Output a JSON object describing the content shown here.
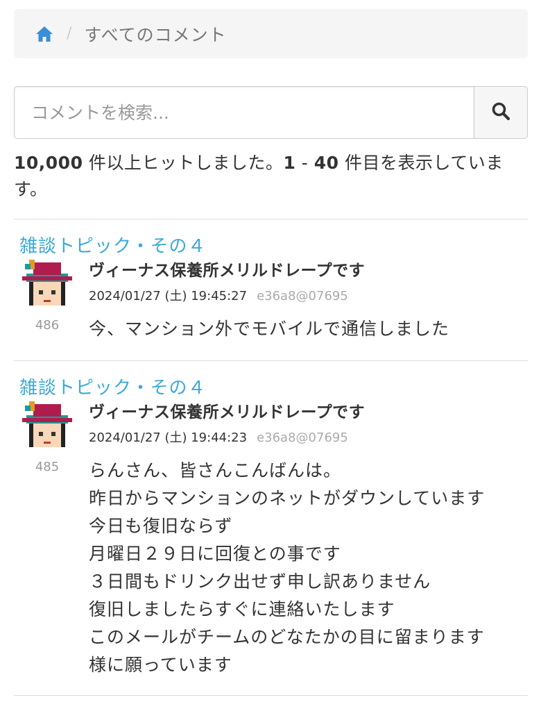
{
  "breadcrumb": {
    "home_icon": "home-icon",
    "separator": "/",
    "current": "すべてのコメント"
  },
  "search": {
    "placeholder": "コメントを検索...",
    "value": "",
    "button_icon": "search-icon"
  },
  "results": {
    "total": "10,000",
    "total_suffix": " 件以上ヒットしました。",
    "range_start": "1",
    "range_sep": " - ",
    "range_end": "40",
    "range_suffix": " 件目を表示しています。"
  },
  "colors": {
    "link": "#3ba9d8",
    "home_icon": "#3a8fd6",
    "breadcrumb_bg": "#f5f5f5"
  },
  "comments": [
    {
      "topic": "雑談トピック・その４",
      "author": "ヴィーナス保養所メリルドレープです",
      "datetime": "2024/01/27 (土) 19:45:27",
      "hash": "e36a8@07695",
      "rank": "486",
      "body": "今、マンション外でモバイルで通信しました"
    },
    {
      "topic": "雑談トピック・その４",
      "author": "ヴィーナス保養所メリルドレープです",
      "datetime": "2024/01/27 (土) 19:44:23",
      "hash": "e36a8@07695",
      "rank": "485",
      "body": "らんさん、皆さんこんばんは。\n昨日からマンションのネットがダウンしています\n今日も復旧ならず\n月曜日２９日に回復との事です\n３日間もドリンク出せず申し訳ありません\n復旧しましたらすぐに連絡いたします\nこのメールがチームのどなたかの目に留まります\n様に願っています"
    }
  ]
}
